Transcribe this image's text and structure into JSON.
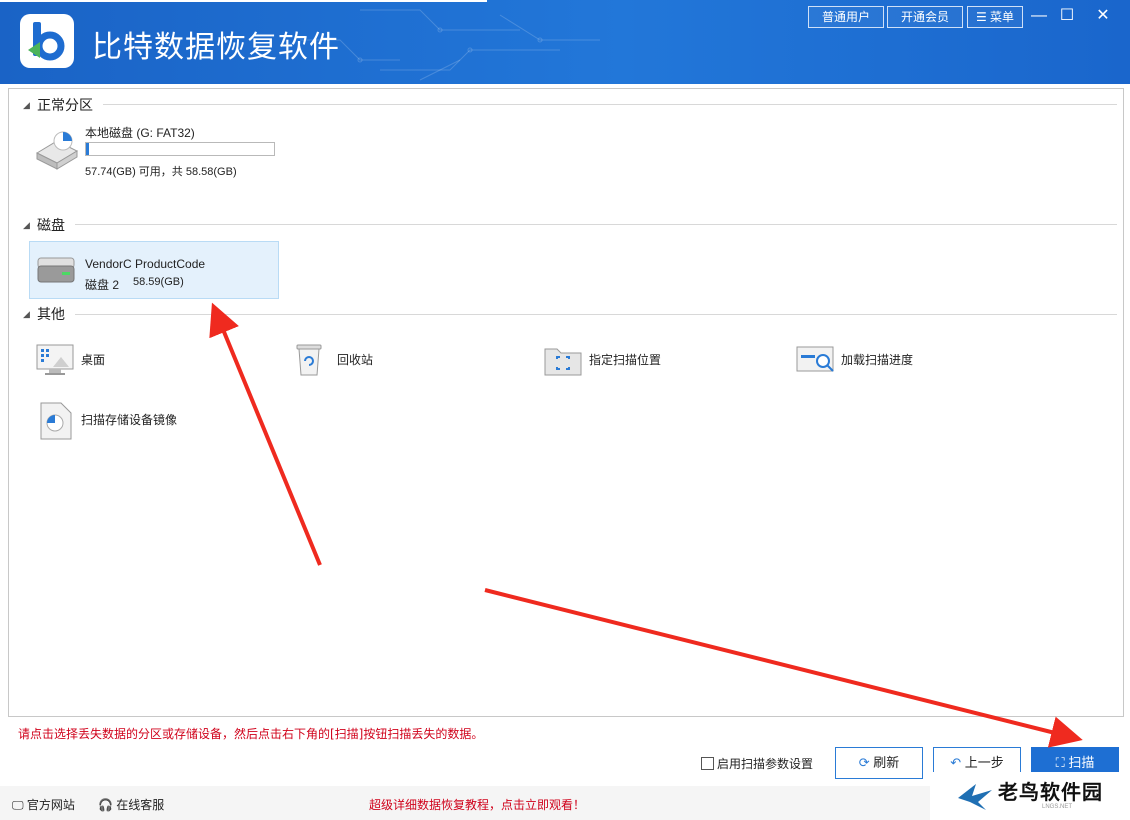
{
  "app": {
    "title": "比特数据恢复软件"
  },
  "header_buttons": {
    "normal_user": "普通用户",
    "vip": "开通会员",
    "menu": "菜单"
  },
  "sections": {
    "partitions": "正常分区",
    "disks": "磁盘",
    "other": "其他"
  },
  "partition": {
    "name": "本地磁盘 (G: FAT32)",
    "usage_text": "57.74(GB) 可用，共 58.58(GB)",
    "used_fraction": 0.014
  },
  "disk": {
    "name": "VendorC ProductCode",
    "label": "磁盘 2",
    "size": "58.59(GB)"
  },
  "other_items": [
    "桌面",
    "回收站",
    "指定扫描位置",
    "加载扫描进度",
    "扫描存储设备镜像"
  ],
  "hint": "请点击选择丢失数据的分区或存储设备，然后点击右下角的[扫描]按钮扫描丢失的数据。",
  "options": {
    "scan_params": "启用扫描参数设置"
  },
  "buttons": {
    "refresh": "刷新",
    "back": "上一步",
    "scan": "扫描"
  },
  "footer": {
    "website": "官方网站",
    "support": "在线客服",
    "tutorial": "超级详细数据恢复教程，点击立即观看！"
  },
  "watermark": {
    "text": "老鸟软件园",
    "sub": "LNGS.NET"
  },
  "colors": {
    "titlebar": "#1e6cd0",
    "accent": "#2a7bd6",
    "hint": "#d0021b",
    "selection": "#e4f1fc"
  }
}
